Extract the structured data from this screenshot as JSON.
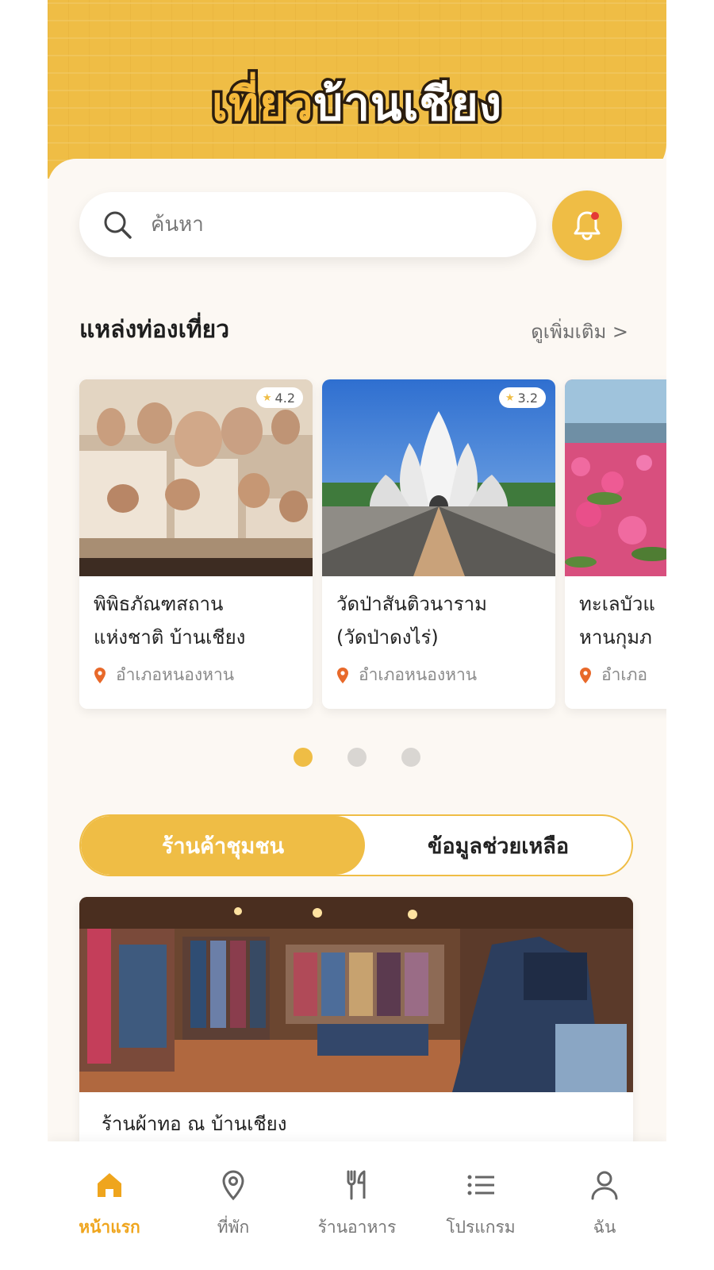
{
  "header": {
    "brand_part1": "เที่ยว",
    "brand_part2": "บ้านเชียง"
  },
  "search": {
    "placeholder": "ค้นหา"
  },
  "attractions": {
    "title": "แหล่งท่องเที่ยว",
    "see_more": "ดูเพิ่มเติม >",
    "cards": [
      {
        "name": "พิพิธภัณฑสถาน\nแห่งชาติ บ้านเชียง",
        "location": "อำเภอหนองหาน",
        "rating": "4.2"
      },
      {
        "name": "วัดป่าสันติวนาราม\n(วัดป่าดงไร่)",
        "location": "อำเภอหนองหาน",
        "rating": "3.2"
      },
      {
        "name": "ทะเลบัวแ\nหานกุมภ",
        "location": "อำเภอ",
        "rating": ""
      }
    ],
    "pagination": {
      "total": 3,
      "active": 1
    }
  },
  "tabs": {
    "community_shop": "ร้านค้าชุมชน",
    "help_info": "ข้อมูลช่วยเหลือ"
  },
  "shop": {
    "name": "ร้านผ้าทอ ณ บ้านเชียง"
  },
  "bottom_nav": [
    {
      "label": "หน้าแรก",
      "icon": "home-icon",
      "active": true
    },
    {
      "label": "ที่พัก",
      "icon": "location-pin-icon",
      "active": false
    },
    {
      "label": "ร้านอาหาร",
      "icon": "utensils-icon",
      "active": false
    },
    {
      "label": "โปรแกรม",
      "icon": "list-icon",
      "active": false
    },
    {
      "label": "ฉัน",
      "icon": "user-icon",
      "active": false
    }
  ],
  "colors": {
    "accent": "#efbd45",
    "background": "#fcf8f3",
    "notification_dot": "#e53935"
  }
}
